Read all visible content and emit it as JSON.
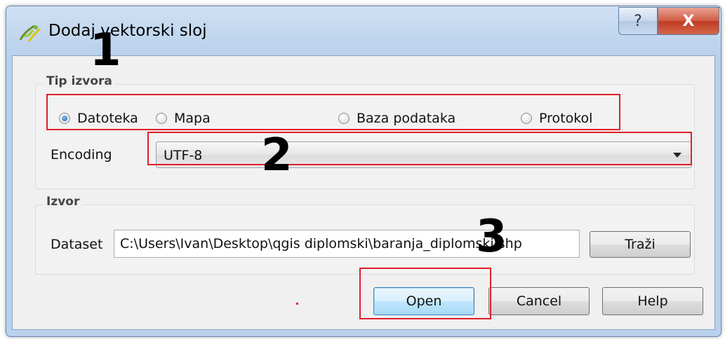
{
  "window": {
    "title": "Dodaj vektorski sloj",
    "help_glyph": "?",
    "close_glyph": "X"
  },
  "source_type": {
    "title": "Tip izvora",
    "options": [
      {
        "label": "Datoteka",
        "checked": true
      },
      {
        "label": "Mapa",
        "checked": false
      },
      {
        "label": "Baza podataka",
        "checked": false
      },
      {
        "label": "Protokol",
        "checked": false
      }
    ],
    "encoding_label": "Encoding",
    "encoding_value": "UTF-8"
  },
  "source": {
    "title": "Izvor",
    "dataset_label": "Dataset",
    "dataset_value": "C:\\Users\\Ivan\\Desktop\\qgis diplomski\\baranja_diplomski.shp",
    "browse_label": "Traži"
  },
  "buttons": {
    "open": "Open",
    "cancel": "Cancel",
    "help": "Help"
  },
  "annotations": [
    "1",
    "2",
    "3"
  ],
  "colors": {
    "highlight": "#e0202a",
    "title_bar": "#b9d1ec",
    "close_button": "#c03a20"
  }
}
